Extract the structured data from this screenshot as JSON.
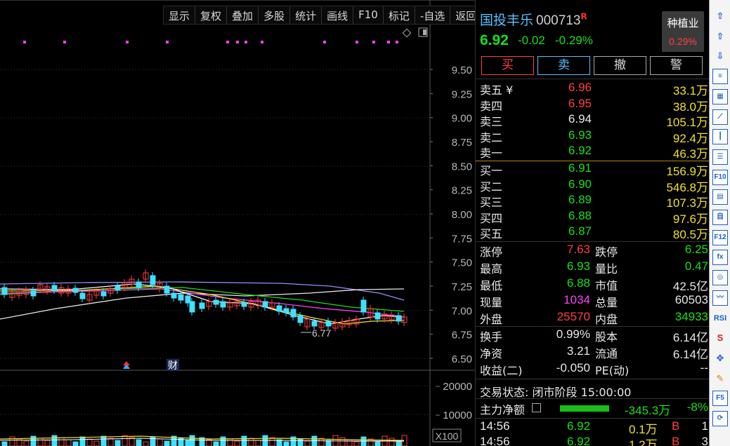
{
  "toolbar": {
    "items": [
      "显示",
      "复权",
      "叠加",
      "多股",
      "统计",
      "画线",
      "F10",
      "标记",
      "-自选",
      "返回"
    ]
  },
  "chart": {
    "price_axis": [
      "9.50",
      "9.25",
      "9.00",
      "8.75",
      "8.50",
      "8.25",
      "8.00",
      "7.75",
      "7.50",
      "7.25",
      "7.00",
      "6.75",
      "6.50"
    ],
    "volume_axis": [
      "20000",
      "10000"
    ],
    "volume_unit": "X100",
    "low_marker": "6.77",
    "event_marker": "财",
    "colors": {
      "up": "#ff4040",
      "down": "#40e0ff",
      "ma5": "#ffffff",
      "ma10": "#f0e030",
      "ma20": "#ff40ff",
      "ma30": "#18e018",
      "ma60": "#9090ff",
      "ma120": "#e8e8e8"
    }
  },
  "quote": {
    "name": "国投丰乐",
    "code": "000713",
    "r_mark": "R",
    "price": "6.92",
    "change": "-0.02",
    "change_pct": "-0.29%",
    "industry_name": "种植业",
    "industry_pct": "0.29%",
    "buttons": {
      "buy": "买",
      "sell": "卖",
      "cancel": "撤",
      "warn": "警"
    },
    "asks": [
      {
        "label": "卖五 ¥",
        "price": "6.96",
        "vol": "33.1万",
        "color": "red"
      },
      {
        "label": "卖四",
        "price": "6.95",
        "vol": "38.0万",
        "color": "red"
      },
      {
        "label": "卖三",
        "price": "6.94",
        "vol": "105.1万",
        "color": "white"
      },
      {
        "label": "卖二",
        "price": "6.93",
        "vol": "92.4万",
        "color": "green"
      },
      {
        "label": "卖一",
        "price": "6.92",
        "vol": "46.3万",
        "color": "green"
      }
    ],
    "bids": [
      {
        "label": "买一",
        "price": "6.91",
        "vol": "156.9万",
        "color": "green"
      },
      {
        "label": "买二",
        "price": "6.90",
        "vol": "546.8万",
        "color": "green"
      },
      {
        "label": "买三",
        "price": "6.89",
        "vol": "107.3万",
        "color": "green"
      },
      {
        "label": "买四",
        "price": "6.88",
        "vol": "97.6万",
        "color": "green"
      },
      {
        "label": "买五",
        "price": "6.87",
        "vol": "80.5万",
        "color": "green"
      }
    ],
    "stats1": [
      {
        "l1": "涨停",
        "v1": "7.63",
        "c1": "red",
        "l2": "跌停",
        "v2": "6.25",
        "c2": "green"
      },
      {
        "l1": "最高",
        "v1": "6.93",
        "c1": "green",
        "l2": "量比",
        "v2": "0.47",
        "c2": "green"
      },
      {
        "l1": "最低",
        "v1": "6.88",
        "c1": "green",
        "l2": "市值",
        "v2": "42.5亿",
        "c2": "white"
      },
      {
        "l1": "现量",
        "v1": "1034",
        "c1": "magenta",
        "l2": "总量",
        "v2": "60503",
        "c2": "white"
      },
      {
        "l1": "外盘",
        "v1": "25570",
        "c1": "red",
        "l2": "内盘",
        "v2": "34933",
        "c2": "green"
      }
    ],
    "stats2": [
      {
        "l1": "换手",
        "v1": "0.99%",
        "c1": "white",
        "l2": "股本",
        "v2": "6.14亿",
        "c2": "white"
      },
      {
        "l1": "净资",
        "v1": "3.21",
        "c1": "white",
        "l2": "流通",
        "v2": "6.14亿",
        "c2": "white"
      },
      {
        "l1": "收益(二)",
        "v1": "-0.050",
        "c1": "white",
        "l2": "PE(动)",
        "v2": "--",
        "c2": "white"
      }
    ],
    "status": "交易状态: 闭市阶段 15:00:00",
    "main_flow": {
      "label": "主力净额",
      "value": "-345.3万",
      "pct": "-8%"
    },
    "ticks": [
      {
        "time": "14:56",
        "price": "6.92",
        "vol": "0.1万",
        "bs": "B",
        "n": "1"
      },
      {
        "time": "14:56",
        "price": "6.92",
        "vol": "1.2万",
        "bs": "B",
        "n": "3"
      }
    ]
  },
  "iconbar": [
    "up-arrow-icon",
    "up-hollow-arrow-icon",
    "down-hollow-arrow-icon",
    "list-icon",
    "grid-icon",
    "line-chart-icon",
    "candle-icon",
    "news-icon",
    "f10-icon",
    "doc-icon",
    "notice-icon",
    "f12-icon",
    "formula-icon",
    "circle-icon",
    "wave-icon",
    "rsi-icon",
    "dollar-icon",
    "move-icon",
    "pen-icon",
    "f5-icon",
    "refresh-icon"
  ],
  "iconbar_labels": [
    "⇧",
    "⇧",
    "⇩",
    "≡",
    "▦",
    "⟋",
    "┃",
    "☰",
    "F10",
    "▤",
    "自",
    "F12",
    "fx",
    "◎",
    "〰",
    "RSI",
    "S",
    "✥",
    "✎",
    "F5",
    "⟳"
  ]
}
